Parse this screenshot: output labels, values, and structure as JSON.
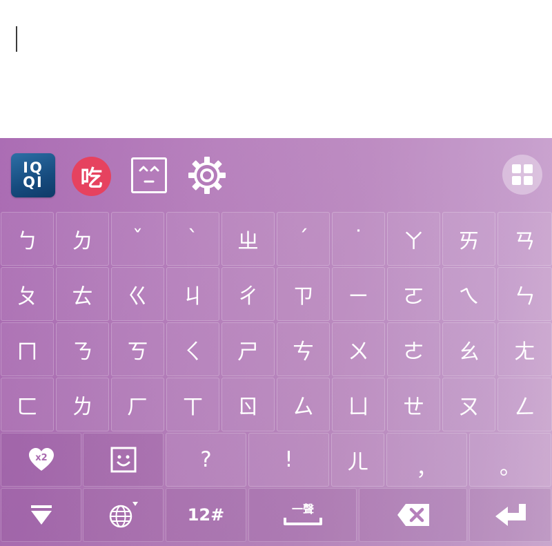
{
  "toolbar": {
    "logo_line1": "IQ",
    "logo_line2": "QI",
    "eat_label": "吃"
  },
  "rows": [
    [
      "ㄅ",
      "ㄉ",
      "ˇ",
      "ˋ",
      "ㄓ",
      "ˊ",
      "˙",
      "ㄚ",
      "ㄞ",
      "ㄢ"
    ],
    [
      "ㄆ",
      "ㄊ",
      "ㄍ",
      "ㄐ",
      "ㄔ",
      "ㄗ",
      "ㄧ",
      "ㄛ",
      "ㄟ",
      "ㄣ"
    ],
    [
      "ㄇ",
      "ㄋ",
      "ㄎ",
      "ㄑ",
      "ㄕ",
      "ㄘ",
      "ㄨ",
      "ㄜ",
      "ㄠ",
      "ㄤ"
    ],
    [
      "ㄈ",
      "ㄌ",
      "ㄏ",
      "ㄒ",
      "ㄖ",
      "ㄙ",
      "ㄩ",
      "ㄝ",
      "ㄡ",
      "ㄥ"
    ]
  ],
  "row5": {
    "heart_badge": "x2",
    "question": "?",
    "exclaim": "!",
    "er": "ㄦ",
    "comma": "，",
    "period": "。"
  },
  "row6": {
    "numbers_label": "12#",
    "first_tone_label": "一聲"
  },
  "colors": {
    "keyboard_start": "#a867b1",
    "keyboard_end": "#d0acd4",
    "eat_badge": "#e6425f",
    "logo": "#164b7e"
  }
}
